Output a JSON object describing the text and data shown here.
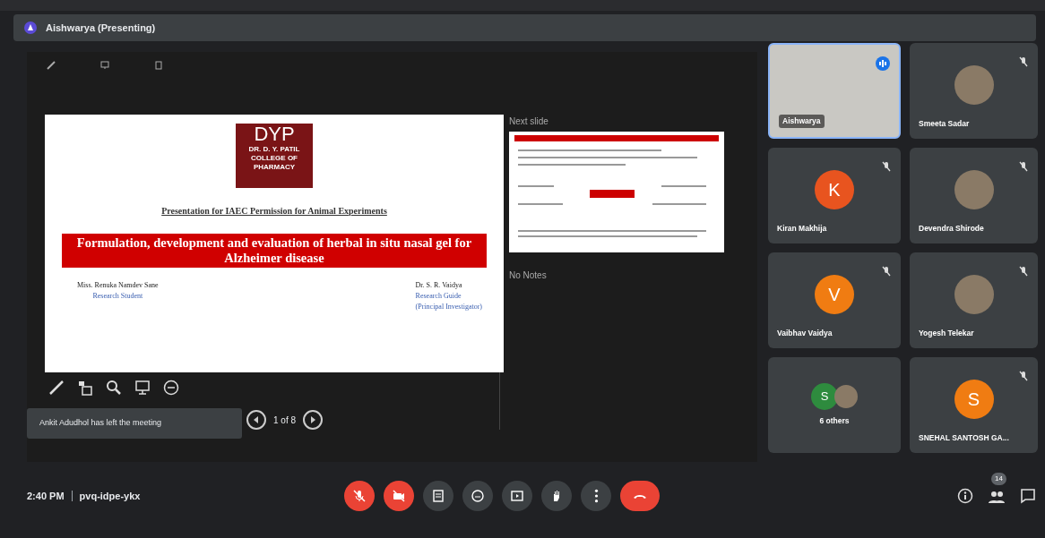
{
  "header": {
    "title": "Aishwarya (Presenting)"
  },
  "presenter_view": {
    "slide": {
      "logo_mark": "DYP",
      "logo_lines": [
        "DR. D. Y. PATIL",
        "COLLEGE OF",
        "PHARMACY"
      ],
      "subtitle": "Presentation for IAEC Permission for Animal Experiments",
      "title": "Formulation, development and evaluation of herbal in situ nasal gel for Alzheimer disease",
      "presenter_name": "Miss. Renuka Namdev Sane",
      "presenter_role": "Research Student",
      "guide_name": "Dr. S. R. Vaidya",
      "guide_role": "Research Guide",
      "guide_note": "(Principal Investigator)"
    },
    "next_slide_label": "Next slide",
    "notes": "No Notes",
    "slide_counter": "1 of 8"
  },
  "notification": "Ankit Adudhol has left the meeting",
  "participants": [
    {
      "name": "Aishwarya",
      "kind": "video",
      "muted": false
    },
    {
      "name": "Smeeta Sadar",
      "kind": "photo",
      "muted": true
    },
    {
      "name": "Kiran Makhija",
      "kind": "initial",
      "initial": "K",
      "color": "#e8541f",
      "muted": true
    },
    {
      "name": "Devendra Shirode",
      "kind": "photo",
      "muted": true
    },
    {
      "name": "Vaibhav Vaidya",
      "kind": "initial",
      "initial": "V",
      "color": "#f07c12",
      "muted": true
    },
    {
      "name": "Yogesh Telekar",
      "kind": "photo",
      "muted": true
    },
    {
      "name": "6 others",
      "kind": "others",
      "initial": "S",
      "color": "#2e8b3e"
    },
    {
      "name": "SNEHAL SANTOSH GA...",
      "kind": "initial",
      "initial": "S",
      "color": "#f07c12",
      "muted": true
    }
  ],
  "bottom_bar": {
    "time": "2:40 PM",
    "meeting_code": "pvq-idpe-ykx",
    "controls": [
      {
        "kind": "mic",
        "off": true
      },
      {
        "kind": "camera",
        "off": true
      },
      {
        "kind": "captions",
        "off": false
      },
      {
        "kind": "emoji",
        "off": false
      },
      {
        "kind": "present",
        "off": false
      },
      {
        "kind": "hand",
        "off": false
      },
      {
        "kind": "more",
        "off": false
      },
      {
        "kind": "end"
      }
    ],
    "people_count": "14"
  }
}
